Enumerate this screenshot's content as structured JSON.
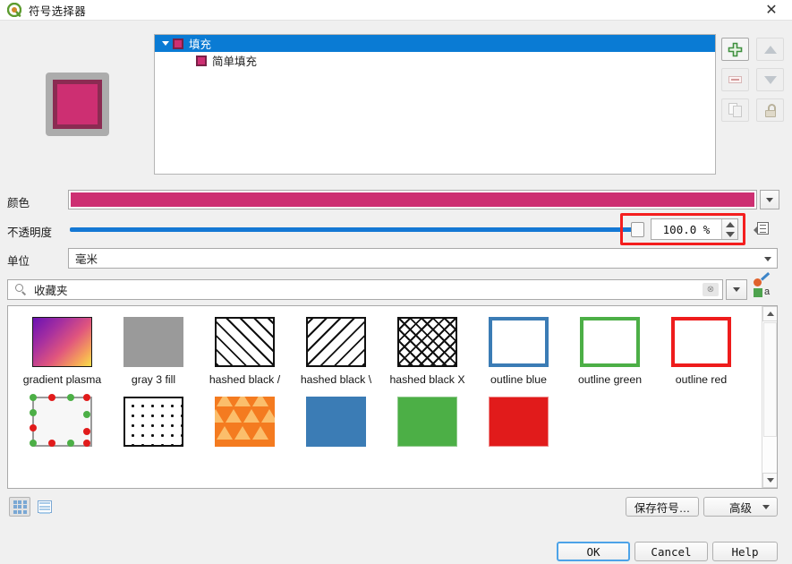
{
  "window": {
    "title": "符号选择器",
    "logo_icon": "qgis-logo-icon",
    "close_label": "✕"
  },
  "layer_tree": {
    "rows": [
      {
        "label": "填充",
        "selected": true,
        "indent": 0,
        "expander": "chevron-down-icon"
      },
      {
        "label": "简单填充",
        "selected": false,
        "indent": 1,
        "expander": ""
      }
    ]
  },
  "layer_buttons": [
    {
      "name": "add-symbol-layer-button",
      "icon": "plus-icon",
      "enabled": true
    },
    {
      "name": "move-up-button",
      "icon": "triangle-up-icon",
      "enabled": false
    },
    {
      "name": "remove-symbol-layer-button",
      "icon": "minus-icon",
      "enabled": false
    },
    {
      "name": "move-down-button",
      "icon": "triangle-down-icon",
      "enabled": false
    },
    {
      "name": "duplicate-layer-button",
      "icon": "duplicate-icon",
      "enabled": false
    },
    {
      "name": "lock-layer-button",
      "icon": "lock-icon",
      "enabled": false
    }
  ],
  "preview": {
    "fill_color": "#cd2f72",
    "stroke_color": "#8b2b52"
  },
  "properties": {
    "color": {
      "label": "颜色",
      "value": "#cd2f72"
    },
    "opacity": {
      "label": "不透明度",
      "value": "100.0 %",
      "percent": 100,
      "highlighted": true
    },
    "unit": {
      "label": "单位",
      "value": "毫米"
    }
  },
  "search": {
    "placeholder": "收藏夹",
    "value": "收藏夹",
    "icon": "search-icon",
    "clear_icon": "clear-icon",
    "dropdown_icon": "chevron-down-icon",
    "style_manager_icon": "style-manager-icon"
  },
  "symbols": [
    {
      "label": "gradient plasma",
      "thumb": "t-grad",
      "name": "symbol-gradient-plasma"
    },
    {
      "label": "gray 3 fill",
      "thumb": "t-gray",
      "name": "symbol-gray-3-fill"
    },
    {
      "label": "hashed black /",
      "thumb": "t-hatch-f",
      "name": "symbol-hashed-black-forward"
    },
    {
      "label": "hashed black \\",
      "thumb": "t-hatch-b",
      "name": "symbol-hashed-black-back"
    },
    {
      "label": "hashed black X",
      "thumb": "t-hatch-x",
      "name": "symbol-hashed-black-x"
    },
    {
      "label": "outline blue",
      "thumb": "t-out-blue",
      "name": "symbol-outline-blue"
    },
    {
      "label": "outline green",
      "thumb": "t-out-green",
      "name": "symbol-outline-green"
    },
    {
      "label": "outline red",
      "thumb": "t-out-red",
      "name": "symbol-outline-red"
    },
    {
      "label": "",
      "thumb": "t-markers",
      "name": "symbol-outline-markers"
    },
    {
      "label": "",
      "thumb": "t-dots",
      "name": "symbol-dotted-black"
    },
    {
      "label": "",
      "thumb": "t-tri",
      "name": "symbol-orange-triangles"
    },
    {
      "label": "",
      "thumb": "t-solid-blue",
      "name": "symbol-solid-blue"
    },
    {
      "label": "",
      "thumb": "t-solid-green",
      "name": "symbol-solid-green"
    },
    {
      "label": "",
      "thumb": "t-solid-red",
      "name": "symbol-solid-red"
    }
  ],
  "view_modes": {
    "grid_icon": "grid-view-icon",
    "list_icon": "list-view-icon",
    "active": "grid"
  },
  "bottom_bar": {
    "save_symbol": "保存符号…",
    "advanced": "高级",
    "advanced_arrow": "chevron-down-icon"
  },
  "dialog_buttons": {
    "ok": "OK",
    "cancel": "Cancel",
    "help": "Help"
  },
  "colors": {
    "accent": "#cd2f72",
    "selection": "#0a7bd4",
    "slider": "#1478d4",
    "highlight_box": "#f41e1e"
  }
}
